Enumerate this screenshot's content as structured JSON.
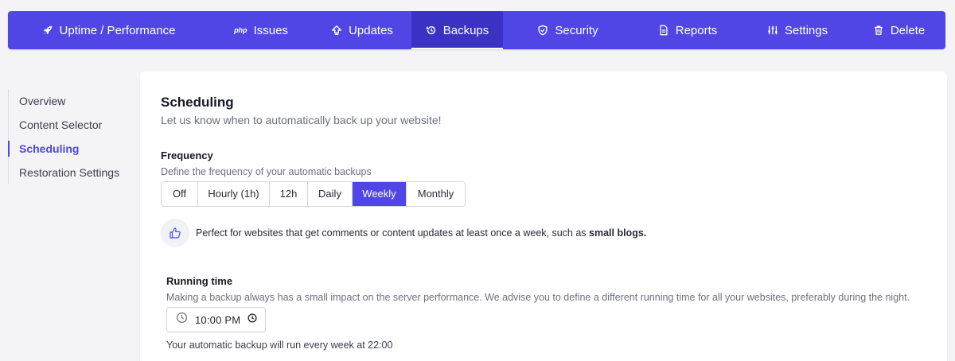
{
  "nav": {
    "tabs": [
      {
        "label": "Uptime / Performance",
        "icon": "rocket-icon"
      },
      {
        "label": "Issues",
        "icon": "php-icon",
        "icon_text": "php"
      },
      {
        "label": "Updates",
        "icon": "upload-icon"
      },
      {
        "label": "Backups",
        "icon": "history-icon",
        "active": true
      },
      {
        "label": "Security",
        "icon": "shield-icon"
      },
      {
        "label": "Reports",
        "icon": "file-icon"
      },
      {
        "label": "Settings",
        "icon": "sliders-icon"
      },
      {
        "label": "Delete",
        "icon": "trash-icon"
      }
    ]
  },
  "sidebar": {
    "items": [
      {
        "label": "Overview"
      },
      {
        "label": "Content Selector"
      },
      {
        "label": "Scheduling",
        "active": true
      },
      {
        "label": "Restoration Settings"
      }
    ]
  },
  "scheduling": {
    "title": "Scheduling",
    "subtitle": "Let us know when to automatically back up your website!"
  },
  "frequency": {
    "title": "Frequency",
    "subtitle": "Define the frequency of your automatic backups",
    "options": [
      "Off",
      "Hourly (1h)",
      "12h",
      "Daily",
      "Weekly",
      "Monthly"
    ],
    "selected": "Weekly",
    "hint_prefix": "Perfect for websites that get comments or content updates at least once a week, such as ",
    "hint_bold": "small blogs."
  },
  "running_time": {
    "title": "Running time",
    "subtitle": "Making a backup always has a small impact on the server performance. We advise you to define a different running time for all your websites, preferably during the night.",
    "value": "10:00 PM",
    "note": "Your automatic backup will run every week at 22:00"
  },
  "colors": {
    "accent": "#4f46e5",
    "accent_dark": "#3b32c4",
    "page_bg": "#f4f4f7"
  }
}
